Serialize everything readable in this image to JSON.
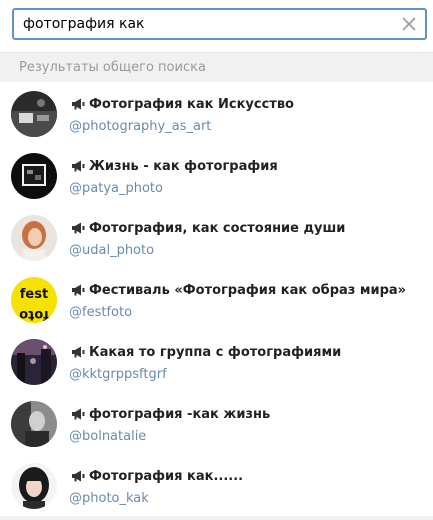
{
  "search": {
    "value": "фотография как",
    "clear_icon": "close-icon"
  },
  "section": {
    "title": "Результаты общего поиска"
  },
  "results": [
    {
      "title": "Фотография как Искусство",
      "handle": "@photography_as_art",
      "icon": "megaphone-icon"
    },
    {
      "title": "Жизнь - как фотография",
      "handle": "@patya_photo",
      "icon": "megaphone-icon"
    },
    {
      "title": "Фотография, как состояние души",
      "handle": "@udal_photo",
      "icon": "megaphone-icon"
    },
    {
      "title": "Фестиваль «Фотография как образ мира»",
      "handle": "@festfoto",
      "icon": "megaphone-icon"
    },
    {
      "title": "Какая то группа с фотографиями",
      "handle": "@kktgrppsftgrf",
      "icon": "megaphone-icon"
    },
    {
      "title": "фотография -как жизнь",
      "handle": "@bolnatalie",
      "icon": "megaphone-icon"
    },
    {
      "title": "Фотография как......",
      "handle": "@photo_kak",
      "icon": "megaphone-icon"
    }
  ],
  "avatar_texts": {
    "fest_top": "fest",
    "fest_bottom": "foto"
  },
  "colors": {
    "accent": "#5c95c4",
    "handle": "#6a8bab",
    "header_bg": "#f1f1f1",
    "fest_yellow": "#f6e200"
  }
}
